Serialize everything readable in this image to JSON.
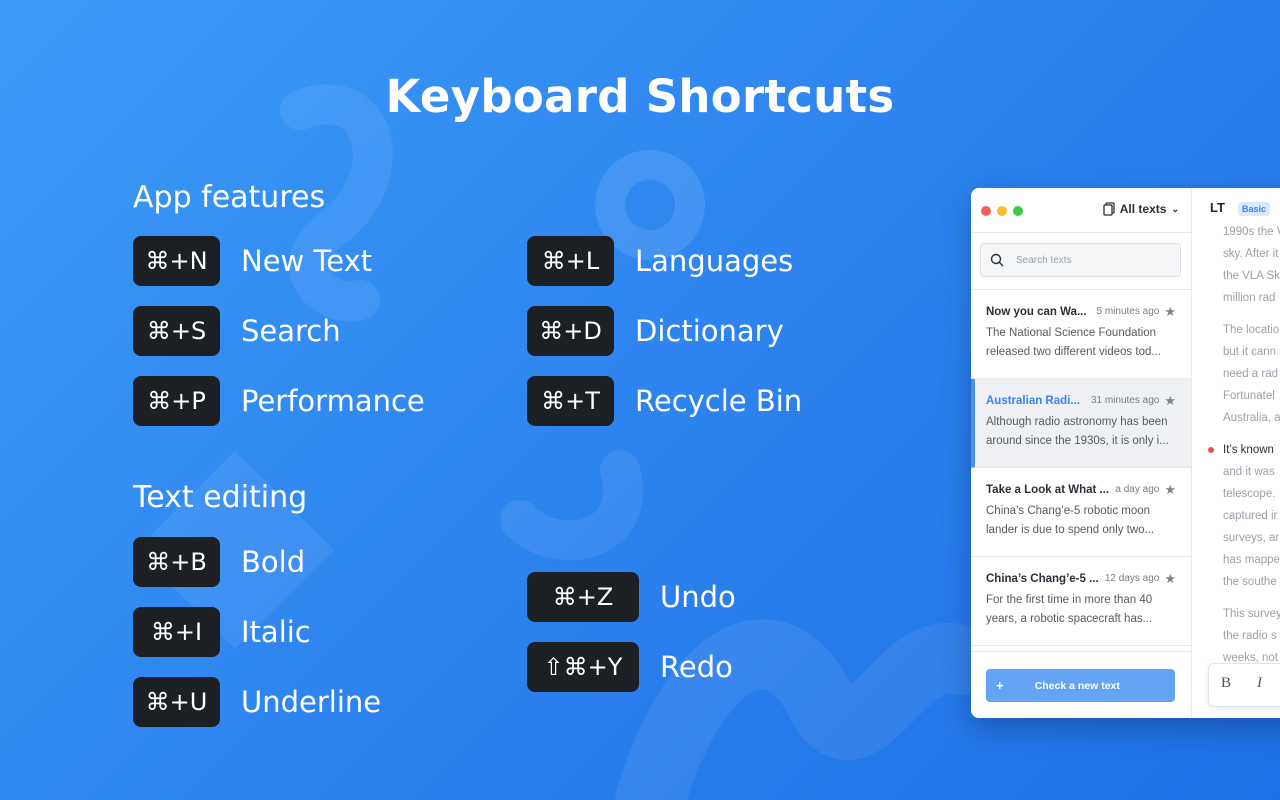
{
  "title": "Keyboard Shortcuts",
  "sections": {
    "app": {
      "heading": "App features"
    },
    "edit": {
      "heading": "Text editing"
    }
  },
  "shortcuts": {
    "new_text": {
      "keys": "⌘+N",
      "label": "New Text"
    },
    "search": {
      "keys": "⌘+S",
      "label": "Search"
    },
    "performance": {
      "keys": "⌘+P",
      "label": "Performance"
    },
    "languages": {
      "keys": "⌘+L",
      "label": "Languages"
    },
    "dictionary": {
      "keys": "⌘+D",
      "label": "Dictionary"
    },
    "recycle_bin": {
      "keys": "⌘+T",
      "label": "Recycle Bin"
    },
    "bold": {
      "keys": "⌘+B",
      "label": "Bold"
    },
    "italic": {
      "keys": "⌘+I",
      "label": "Italic"
    },
    "underline": {
      "keys": "⌘+U",
      "label": "Underline"
    },
    "undo": {
      "keys": "⌘+Z",
      "label": "Undo"
    },
    "redo": {
      "keys": "⇧⌘+Y",
      "label": "Redo"
    }
  },
  "app_window": {
    "dropdown_label": "All texts",
    "search_placeholder": "Search texts",
    "texts": [
      {
        "title": "Now you can Wa...",
        "time": "5 minutes ago",
        "line1": "The National Science Foundation",
        "line2": "released two different videos tod..."
      },
      {
        "title": "Australian Radi...",
        "time": "31 minutes ago",
        "line1": "Although radio astronomy has been",
        "line2": "around since the 1930s, it is only i..."
      },
      {
        "title": "Take a Look at What ...",
        "time": "a day ago",
        "line1": "China’s Chang’e-5 robotic moon",
        "line2": "lander is due to spend only two..."
      },
      {
        "title": "China’s Chang’e-5 ...",
        "time": "12 days ago",
        "line1": "For the first time in more than 40",
        "line2": "years, a robotic spacecraft has..."
      }
    ],
    "check_button": "Check a new text",
    "editor": {
      "logo": "LT",
      "badge": "Basic",
      "lines": [
        "1990s the V",
        "sky. After it",
        "the VLA Sky",
        "million rad",
        "The locatio",
        "but it cann",
        "need a rad",
        "Fortunatel",
        "Australia, a",
        "It’s known",
        "and it was",
        "telescope.",
        "captured ir",
        "surveys, ar",
        "has mappe",
        "the southe",
        "This survey",
        "the radio s",
        "weeks, not"
      ],
      "format_bold": "B",
      "format_italic": "I"
    }
  },
  "colors": {
    "bg_start": "#3b9bf6",
    "bg_end": "#1f6fe8",
    "key_bg": "#1c1f24",
    "accent": "#3b82f6"
  }
}
